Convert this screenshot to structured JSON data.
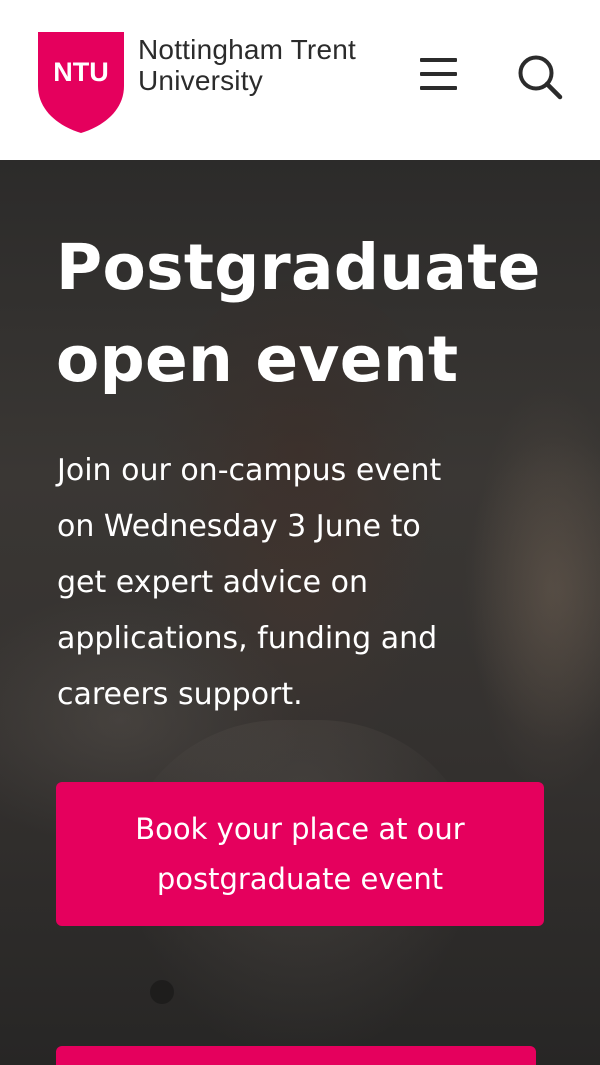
{
  "header": {
    "logo_badge": "NTU",
    "logo_line1": "Nottingham Trent",
    "logo_line2": "University",
    "menu_icon": "hamburger-menu-icon",
    "search_icon": "search-icon"
  },
  "hero": {
    "title_line1": "Postgraduate",
    "title_line2": "open event",
    "intro_lines": [
      "Join our on-campus event",
      "on Wednesday 3 June to",
      "get expert advice on",
      "applications, funding and",
      "careers support."
    ],
    "cta_line1": "Book your place at our",
    "cta_line2": "postgraduate event"
  },
  "colors": {
    "brand_pink": "#e5005d",
    "header_text": "#2b2b2b",
    "hero_text": "#ffffff"
  }
}
